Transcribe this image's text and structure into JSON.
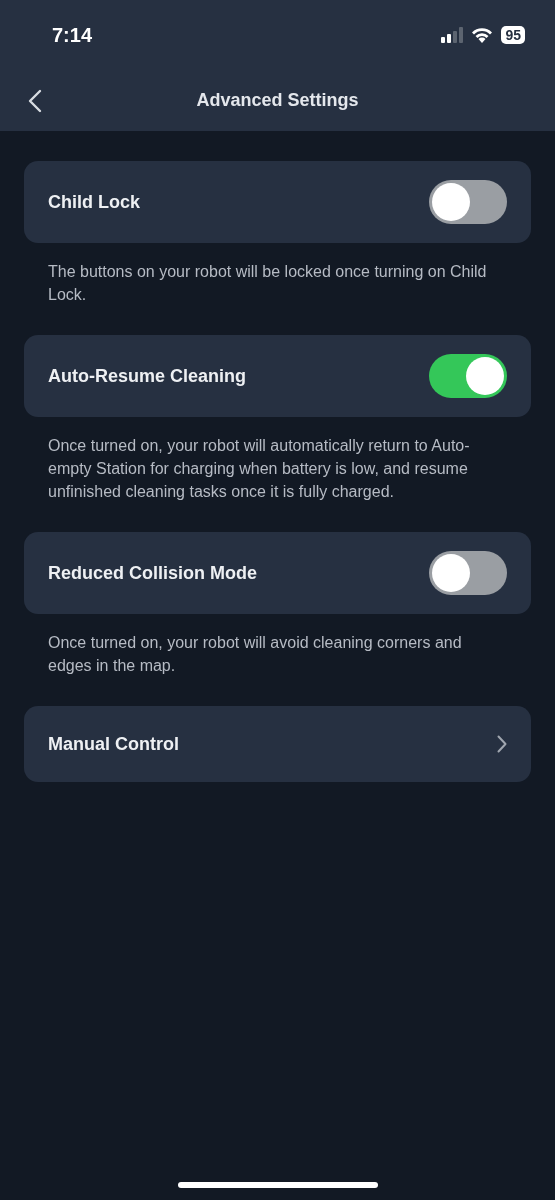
{
  "status_bar": {
    "time": "7:14",
    "battery": "95"
  },
  "header": {
    "title": "Advanced Settings"
  },
  "settings": [
    {
      "kind": "toggle",
      "label": "Child Lock",
      "on": false,
      "description": "The buttons on your robot will be locked once turning on Child Lock."
    },
    {
      "kind": "toggle",
      "label": "Auto-Resume Cleaning",
      "on": true,
      "description": "Once turned on, your robot will automatically return to Auto-empty Station for charging when battery is low, and resume unfinished cleaning tasks once it is fully charged."
    },
    {
      "kind": "toggle",
      "label": "Reduced Collision Mode",
      "on": false,
      "description": "Once turned on, your robot will avoid cleaning corners and edges in the map."
    },
    {
      "kind": "link",
      "label": "Manual Control"
    }
  ]
}
